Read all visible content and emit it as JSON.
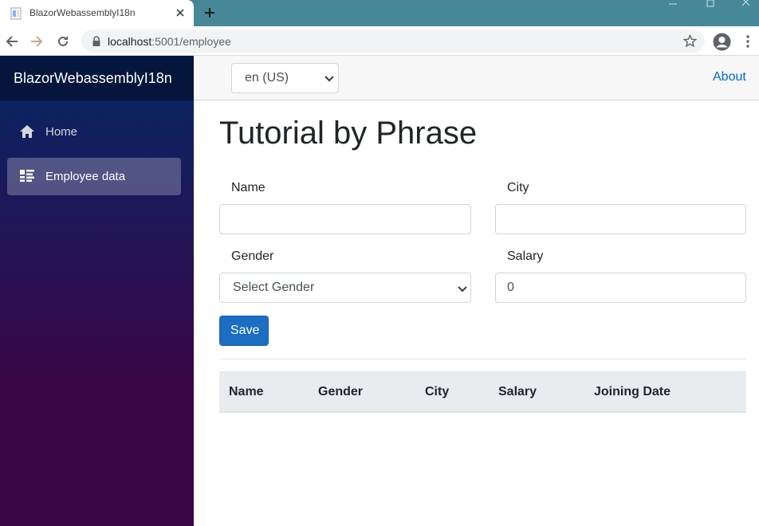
{
  "browser": {
    "tab_title": "BlazorWebassemblyI18n",
    "url_host": "localhost",
    "url_path": ":5001/employee"
  },
  "sidebar": {
    "brand": "BlazorWebassemblyI18n",
    "items": [
      {
        "label": "Home",
        "icon": "home-icon",
        "active": false
      },
      {
        "label": "Employee data",
        "icon": "list-icon",
        "active": true
      }
    ]
  },
  "topbar": {
    "language": "en (US)",
    "about": "About"
  },
  "main": {
    "title": "Tutorial by Phrase",
    "form": {
      "name_label": "Name",
      "name_value": "",
      "city_label": "City",
      "city_value": "",
      "gender_label": "Gender",
      "gender_value": "Select Gender",
      "salary_label": "Salary",
      "salary_value": "0",
      "save_label": "Save"
    },
    "table": {
      "headers": [
        "Name",
        "Gender",
        "City",
        "Salary",
        "Joining Date"
      ],
      "rows": []
    }
  },
  "colors": {
    "tabbar": "#468897",
    "primary_button": "#1b6ec2",
    "link": "#0366d6",
    "sidebar_top": "#052767",
    "sidebar_bottom": "#3a0647"
  }
}
